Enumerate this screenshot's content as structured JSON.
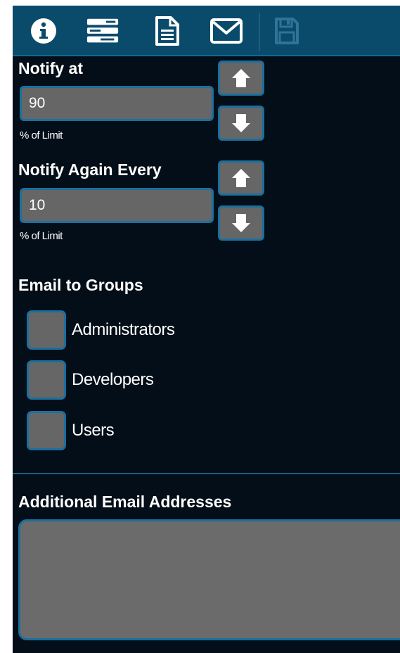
{
  "toolbar": {
    "icons": [
      "info-icon",
      "server-list-icon",
      "document-icon",
      "envelope-icon",
      "save-icon"
    ],
    "accent": "#0a4b6c"
  },
  "notify_at": {
    "label": "Notify at",
    "value": "90",
    "unit": "% of Limit"
  },
  "notify_again": {
    "label": "Notify Again Every",
    "value": "10",
    "unit": "% of Limit"
  },
  "email_groups": {
    "label": "Email to Groups",
    "items": [
      {
        "label": "Administrators",
        "checked": false
      },
      {
        "label": "Developers",
        "checked": false
      },
      {
        "label": "Users",
        "checked": false
      }
    ]
  },
  "additional_emails": {
    "label": "Additional Email Addresses",
    "value": ""
  },
  "colors": {
    "panel_bg": "#030e18",
    "input_bg": "#666666",
    "border": "#1a6f9d"
  }
}
